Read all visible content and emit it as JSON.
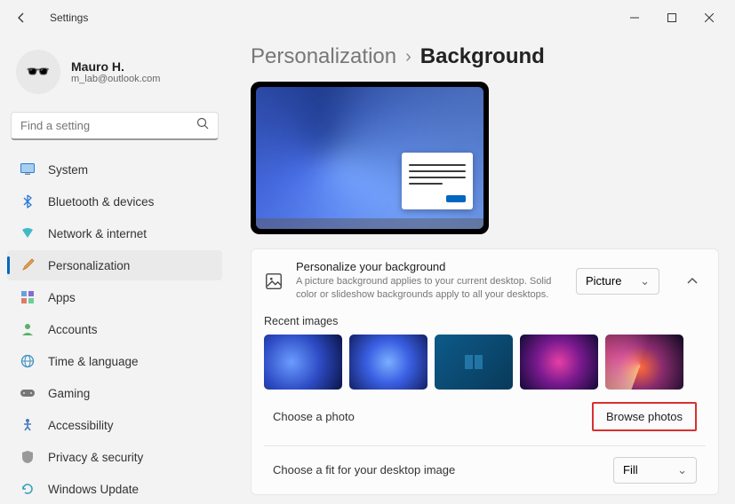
{
  "window": {
    "title": "Settings"
  },
  "user": {
    "name": "Mauro H.",
    "email": "m_lab@outlook.com"
  },
  "search": {
    "placeholder": "Find a setting"
  },
  "nav": {
    "items": [
      {
        "label": "System",
        "icon": "💻"
      },
      {
        "label": "Bluetooth & devices",
        "icon": "bt"
      },
      {
        "label": "Network & internet",
        "icon": "🔷"
      },
      {
        "label": "Personalization",
        "icon": "🖌️",
        "active": true
      },
      {
        "label": "Apps",
        "icon": "🗔"
      },
      {
        "label": "Accounts",
        "icon": "👤"
      },
      {
        "label": "Time & language",
        "icon": "🌐"
      },
      {
        "label": "Gaming",
        "icon": "🎮"
      },
      {
        "label": "Accessibility",
        "icon": "♿"
      },
      {
        "label": "Privacy & security",
        "icon": "🛡️"
      },
      {
        "label": "Windows Update",
        "icon": "🔄"
      }
    ]
  },
  "breadcrumb": {
    "parent": "Personalization",
    "current": "Background"
  },
  "personalize_card": {
    "title": "Personalize your background",
    "description": "A picture background applies to your current desktop. Solid color or slideshow backgrounds apply to all your desktops.",
    "select_value": "Picture"
  },
  "recent": {
    "title": "Recent images"
  },
  "choose_photo": {
    "label": "Choose a photo",
    "button": "Browse photos"
  },
  "fit": {
    "label": "Choose a fit for your desktop image",
    "select_value": "Fill"
  }
}
